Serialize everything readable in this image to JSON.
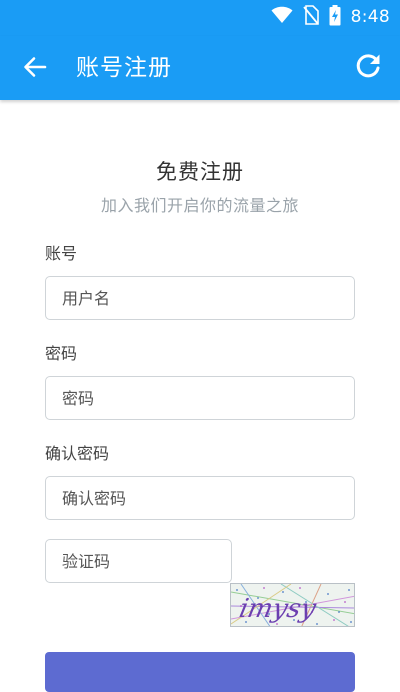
{
  "status_bar": {
    "time": "8:48",
    "icons": [
      "wifi-icon",
      "no-sim-icon",
      "battery-charging-icon"
    ]
  },
  "app_bar": {
    "title": "账号注册",
    "back_icon": "arrow-left-icon",
    "refresh_icon": "refresh-icon"
  },
  "form": {
    "heading": "免费注册",
    "subheading": "加入我们开启你的流量之旅",
    "account": {
      "label": "账号",
      "placeholder": "用户名"
    },
    "password": {
      "label": "密码",
      "placeholder": "密码"
    },
    "confirm_password": {
      "label": "确认密码",
      "placeholder": "确认密码"
    },
    "captcha": {
      "placeholder": "验证码",
      "image_text": "imysy"
    }
  },
  "colors": {
    "primary": "#1a9cf5",
    "submit_button": "#5d6bd1",
    "subtitle": "#9aa3aa",
    "input_border": "#cfd4d8"
  }
}
